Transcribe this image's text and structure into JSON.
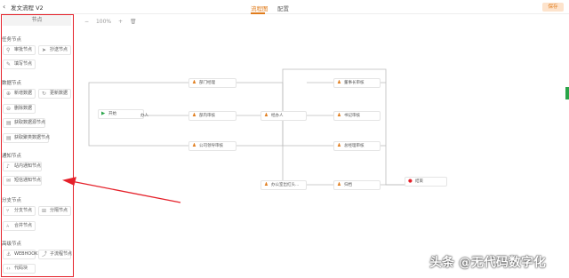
{
  "header": {
    "back_icon": "back-arrow-icon",
    "title": "发文流程 V2",
    "tabs": [
      {
        "label": "流程图",
        "active": true
      },
      {
        "label": "配置",
        "active": false
      }
    ],
    "save_label": "保存"
  },
  "zoom": {
    "minus": "−",
    "level": "100%",
    "plus": "+",
    "delete_icon": "trash-icon"
  },
  "sidebar": {
    "header": "节点",
    "sections": [
      {
        "title": "任务节点",
        "items": [
          "审批节点",
          "抄送节点",
          "填写节点"
        ]
      },
      {
        "title": "数据节点",
        "items": [
          "新增数据",
          "更新数据",
          "删除数据",
          "获取数据源节点",
          "获取聚类数据节点"
        ]
      },
      {
        "title": "通知节点",
        "items": [
          "站内通知节点",
          "短信通知节点"
        ]
      },
      {
        "title": "分支节点",
        "items": [
          "分支节点",
          "分隔节点",
          "合并节点"
        ]
      },
      {
        "title": "高级节点",
        "items": [
          "WEBHOOK",
          "子流程节点",
          "代码块"
        ]
      }
    ]
  },
  "flow": {
    "nodes": [
      {
        "id": "start",
        "label": "开始",
        "icon": "play-icon"
      },
      {
        "id": "n1",
        "label": "办人"
      },
      {
        "id": "dept_mgr",
        "label": "部门经理"
      },
      {
        "id": "dept_review",
        "label": "部内审核"
      },
      {
        "id": "company_leader",
        "label": "公司领导审核"
      },
      {
        "id": "handler",
        "label": "经办人"
      },
      {
        "id": "chairman",
        "label": "董事长审核"
      },
      {
        "id": "secretary",
        "label": "书记审核"
      },
      {
        "id": "general_mgr",
        "label": "总经理审核"
      },
      {
        "id": "office",
        "label": "办公室出红头..."
      },
      {
        "id": "archive",
        "label": "归档"
      },
      {
        "id": "end",
        "label": "结束",
        "icon": "stop-icon"
      }
    ]
  },
  "colors": {
    "accent": "#e07b1a",
    "highlight": "#e5212a",
    "success": "#2aa54a"
  },
  "watermark": "头条 @无代码数字化"
}
